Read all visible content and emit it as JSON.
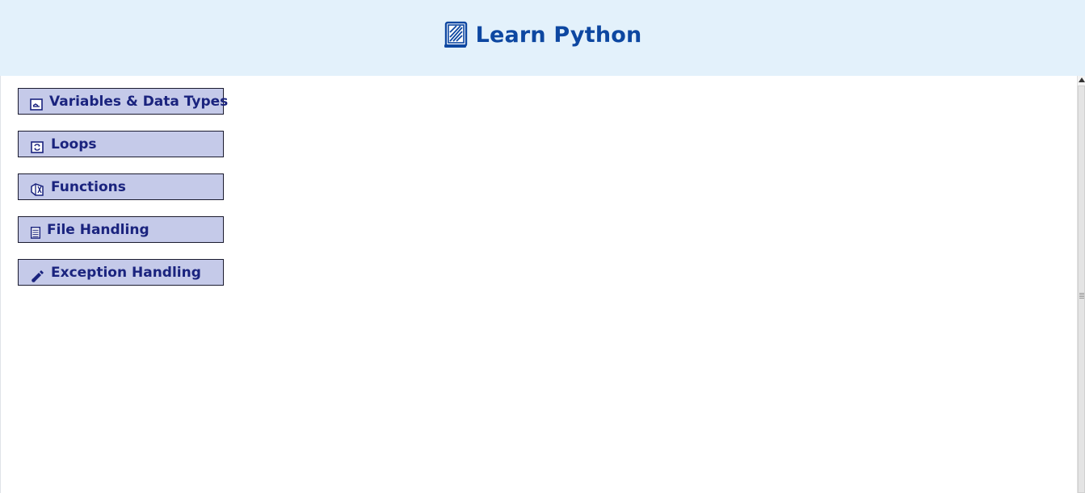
{
  "header": {
    "title": "Learn Python",
    "icon": "book-icon",
    "background": "#e3f1fb",
    "title_color": "#0d47a1"
  },
  "menu": {
    "button_background": "#c5cae9",
    "label_color": "#1a237e",
    "items": [
      {
        "label": "Variables & Data Types",
        "icon": "variable-box-icon"
      },
      {
        "label": "Loops",
        "icon": "loop-icon"
      },
      {
        "label": "Functions",
        "icon": "function-icon"
      },
      {
        "label": "File Handling",
        "icon": "file-icon"
      },
      {
        "label": "Exception Handling",
        "icon": "exception-pen-icon"
      }
    ]
  }
}
